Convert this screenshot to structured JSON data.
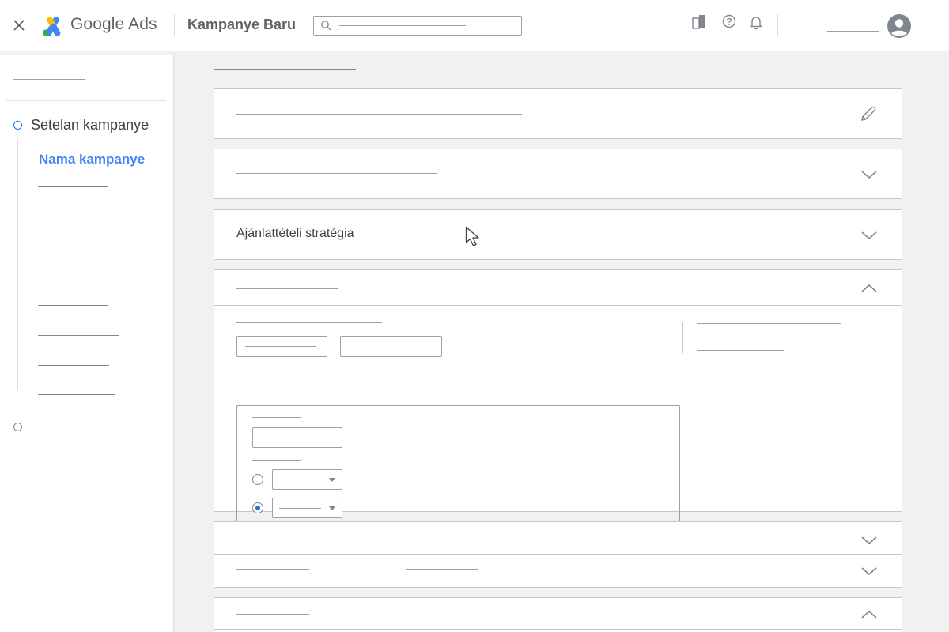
{
  "header": {
    "brand_name": "Google Ads",
    "campaign_title": "Kampanye Baru",
    "icons": [
      "close-icon",
      "google-ads-logo",
      "search-icon",
      "reports-icon",
      "help-icon",
      "notifications-icon",
      "account-avatar-icon"
    ]
  },
  "sidebar": {
    "step_active_label": "Setelan kampanye",
    "sub_active_label": "Nama kampanye"
  },
  "main": {
    "bidding_label": "Ajánlattételi stratégia"
  },
  "colors": {
    "accent": "#1a73e8",
    "active_link": "#4285f4",
    "background": "#f1f1f1"
  }
}
